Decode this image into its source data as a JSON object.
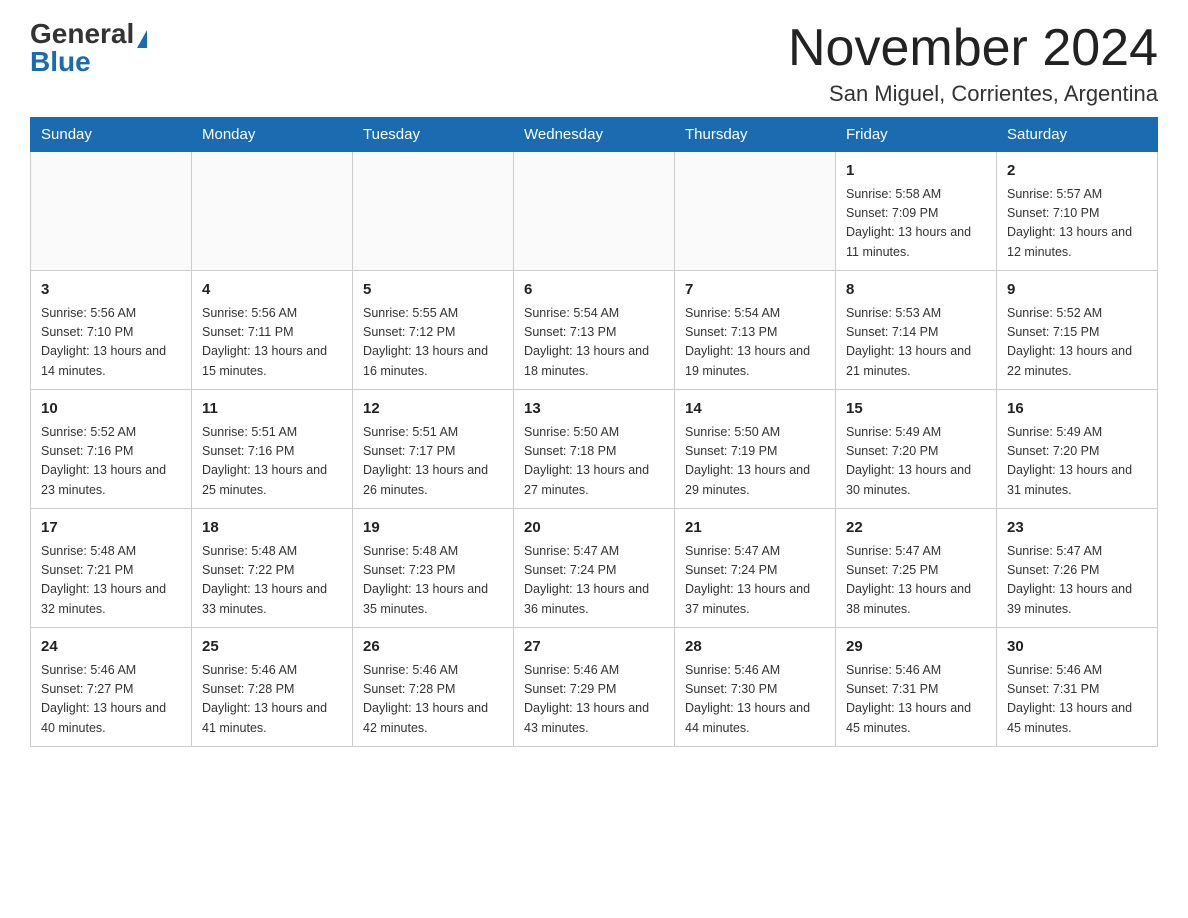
{
  "header": {
    "logo_general": "General",
    "logo_blue": "Blue",
    "month_title": "November 2024",
    "location": "San Miguel, Corrientes, Argentina"
  },
  "weekdays": [
    "Sunday",
    "Monday",
    "Tuesday",
    "Wednesday",
    "Thursday",
    "Friday",
    "Saturday"
  ],
  "weeks": [
    [
      {
        "day": "",
        "sunrise": "",
        "sunset": "",
        "daylight": ""
      },
      {
        "day": "",
        "sunrise": "",
        "sunset": "",
        "daylight": ""
      },
      {
        "day": "",
        "sunrise": "",
        "sunset": "",
        "daylight": ""
      },
      {
        "day": "",
        "sunrise": "",
        "sunset": "",
        "daylight": ""
      },
      {
        "day": "",
        "sunrise": "",
        "sunset": "",
        "daylight": ""
      },
      {
        "day": "1",
        "sunrise": "Sunrise: 5:58 AM",
        "sunset": "Sunset: 7:09 PM",
        "daylight": "Daylight: 13 hours and 11 minutes."
      },
      {
        "day": "2",
        "sunrise": "Sunrise: 5:57 AM",
        "sunset": "Sunset: 7:10 PM",
        "daylight": "Daylight: 13 hours and 12 minutes."
      }
    ],
    [
      {
        "day": "3",
        "sunrise": "Sunrise: 5:56 AM",
        "sunset": "Sunset: 7:10 PM",
        "daylight": "Daylight: 13 hours and 14 minutes."
      },
      {
        "day": "4",
        "sunrise": "Sunrise: 5:56 AM",
        "sunset": "Sunset: 7:11 PM",
        "daylight": "Daylight: 13 hours and 15 minutes."
      },
      {
        "day": "5",
        "sunrise": "Sunrise: 5:55 AM",
        "sunset": "Sunset: 7:12 PM",
        "daylight": "Daylight: 13 hours and 16 minutes."
      },
      {
        "day": "6",
        "sunrise": "Sunrise: 5:54 AM",
        "sunset": "Sunset: 7:13 PM",
        "daylight": "Daylight: 13 hours and 18 minutes."
      },
      {
        "day": "7",
        "sunrise": "Sunrise: 5:54 AM",
        "sunset": "Sunset: 7:13 PM",
        "daylight": "Daylight: 13 hours and 19 minutes."
      },
      {
        "day": "8",
        "sunrise": "Sunrise: 5:53 AM",
        "sunset": "Sunset: 7:14 PM",
        "daylight": "Daylight: 13 hours and 21 minutes."
      },
      {
        "day": "9",
        "sunrise": "Sunrise: 5:52 AM",
        "sunset": "Sunset: 7:15 PM",
        "daylight": "Daylight: 13 hours and 22 minutes."
      }
    ],
    [
      {
        "day": "10",
        "sunrise": "Sunrise: 5:52 AM",
        "sunset": "Sunset: 7:16 PM",
        "daylight": "Daylight: 13 hours and 23 minutes."
      },
      {
        "day": "11",
        "sunrise": "Sunrise: 5:51 AM",
        "sunset": "Sunset: 7:16 PM",
        "daylight": "Daylight: 13 hours and 25 minutes."
      },
      {
        "day": "12",
        "sunrise": "Sunrise: 5:51 AM",
        "sunset": "Sunset: 7:17 PM",
        "daylight": "Daylight: 13 hours and 26 minutes."
      },
      {
        "day": "13",
        "sunrise": "Sunrise: 5:50 AM",
        "sunset": "Sunset: 7:18 PM",
        "daylight": "Daylight: 13 hours and 27 minutes."
      },
      {
        "day": "14",
        "sunrise": "Sunrise: 5:50 AM",
        "sunset": "Sunset: 7:19 PM",
        "daylight": "Daylight: 13 hours and 29 minutes."
      },
      {
        "day": "15",
        "sunrise": "Sunrise: 5:49 AM",
        "sunset": "Sunset: 7:20 PM",
        "daylight": "Daylight: 13 hours and 30 minutes."
      },
      {
        "day": "16",
        "sunrise": "Sunrise: 5:49 AM",
        "sunset": "Sunset: 7:20 PM",
        "daylight": "Daylight: 13 hours and 31 minutes."
      }
    ],
    [
      {
        "day": "17",
        "sunrise": "Sunrise: 5:48 AM",
        "sunset": "Sunset: 7:21 PM",
        "daylight": "Daylight: 13 hours and 32 minutes."
      },
      {
        "day": "18",
        "sunrise": "Sunrise: 5:48 AM",
        "sunset": "Sunset: 7:22 PM",
        "daylight": "Daylight: 13 hours and 33 minutes."
      },
      {
        "day": "19",
        "sunrise": "Sunrise: 5:48 AM",
        "sunset": "Sunset: 7:23 PM",
        "daylight": "Daylight: 13 hours and 35 minutes."
      },
      {
        "day": "20",
        "sunrise": "Sunrise: 5:47 AM",
        "sunset": "Sunset: 7:24 PM",
        "daylight": "Daylight: 13 hours and 36 minutes."
      },
      {
        "day": "21",
        "sunrise": "Sunrise: 5:47 AM",
        "sunset": "Sunset: 7:24 PM",
        "daylight": "Daylight: 13 hours and 37 minutes."
      },
      {
        "day": "22",
        "sunrise": "Sunrise: 5:47 AM",
        "sunset": "Sunset: 7:25 PM",
        "daylight": "Daylight: 13 hours and 38 minutes."
      },
      {
        "day": "23",
        "sunrise": "Sunrise: 5:47 AM",
        "sunset": "Sunset: 7:26 PM",
        "daylight": "Daylight: 13 hours and 39 minutes."
      }
    ],
    [
      {
        "day": "24",
        "sunrise": "Sunrise: 5:46 AM",
        "sunset": "Sunset: 7:27 PM",
        "daylight": "Daylight: 13 hours and 40 minutes."
      },
      {
        "day": "25",
        "sunrise": "Sunrise: 5:46 AM",
        "sunset": "Sunset: 7:28 PM",
        "daylight": "Daylight: 13 hours and 41 minutes."
      },
      {
        "day": "26",
        "sunrise": "Sunrise: 5:46 AM",
        "sunset": "Sunset: 7:28 PM",
        "daylight": "Daylight: 13 hours and 42 minutes."
      },
      {
        "day": "27",
        "sunrise": "Sunrise: 5:46 AM",
        "sunset": "Sunset: 7:29 PM",
        "daylight": "Daylight: 13 hours and 43 minutes."
      },
      {
        "day": "28",
        "sunrise": "Sunrise: 5:46 AM",
        "sunset": "Sunset: 7:30 PM",
        "daylight": "Daylight: 13 hours and 44 minutes."
      },
      {
        "day": "29",
        "sunrise": "Sunrise: 5:46 AM",
        "sunset": "Sunset: 7:31 PM",
        "daylight": "Daylight: 13 hours and 45 minutes."
      },
      {
        "day": "30",
        "sunrise": "Sunrise: 5:46 AM",
        "sunset": "Sunset: 7:31 PM",
        "daylight": "Daylight: 13 hours and 45 minutes."
      }
    ]
  ]
}
